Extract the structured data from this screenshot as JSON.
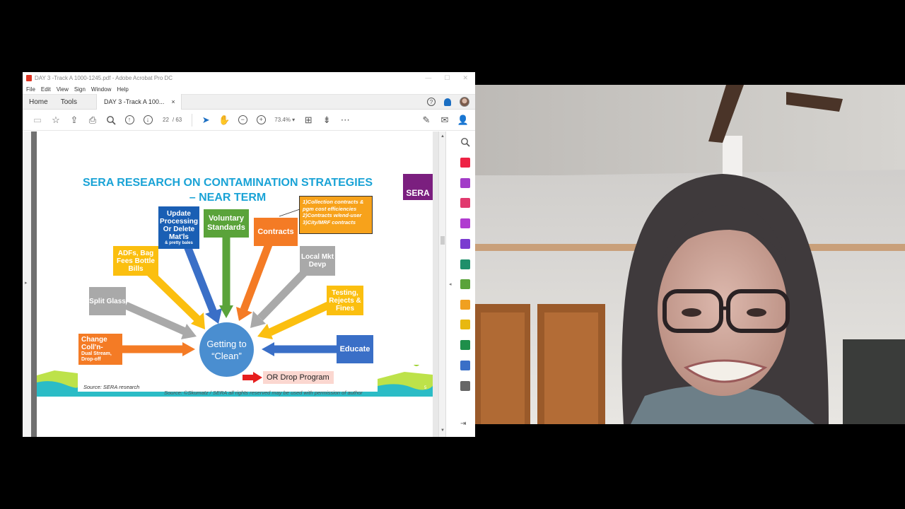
{
  "window": {
    "title": "DAY 3 -Track A 1000-1245.pdf - Adobe Acrobat Pro DC",
    "menu": [
      "File",
      "Edit",
      "View",
      "Sign",
      "Window",
      "Help"
    ],
    "tabs": {
      "home": "Home",
      "tools": "Tools",
      "document_tab": "DAY 3 -Track A 100..."
    },
    "toolbar": {
      "page_current": "22",
      "page_total": "/ 63",
      "zoom": "73.4%"
    },
    "close_glyph": "×"
  },
  "slide": {
    "title": "SERA RESEARCH ON CONTAMINATION STRATEGIES – NEAR TERM",
    "logo": "SERA",
    "hub": "Getting to “Clean”",
    "boxes": {
      "update": "Update Processing Or Delete Mat'ls",
      "update_small": "& pretty bales",
      "voluntary": "Voluntary Standards",
      "contracts": "Contracts",
      "adfs": "ADFs, Bag Fees Bottle Bills",
      "local": "Local Mkt Devp",
      "split": "Split Glass",
      "testing": "Testing, Rejects & Fines",
      "change": "Change Coll'n-",
      "change_small": "Dual Stream, Drop-off",
      "educate": "Educate"
    },
    "note_lines": [
      "1)Collection contracts &",
      "pgm cost efficiencies",
      "2)Contracts w/end-user",
      "3)City/MRF contracts"
    ],
    "drop_program": "OR Drop Program",
    "source": "Source: SERA research",
    "copyright": "Source: ©Skumatz / SERA    all rights reserved    may be used with permission of author",
    "page_number": "5"
  },
  "colors": {
    "title_blue": "#1aa3d6",
    "sera_purple": "#7b1f7f",
    "yellow": "#fbbf0f",
    "green": "#5aa33a",
    "orange": "#f47b25",
    "gray": "#a9a9a9",
    "blue": "#4a8ed0",
    "dark_blue": "#1a5fb4"
  },
  "icons": [
    "save-icon",
    "star-icon",
    "upload-icon",
    "print-icon",
    "search-icon",
    "prev-page-icon",
    "next-page-icon",
    "select-cursor-icon",
    "hand-icon",
    "zoom-out-icon",
    "zoom-in-icon",
    "fit-page-icon",
    "scroll-mode-icon",
    "more-icon",
    "sign-icon",
    "mail-icon",
    "share-user-icon"
  ]
}
